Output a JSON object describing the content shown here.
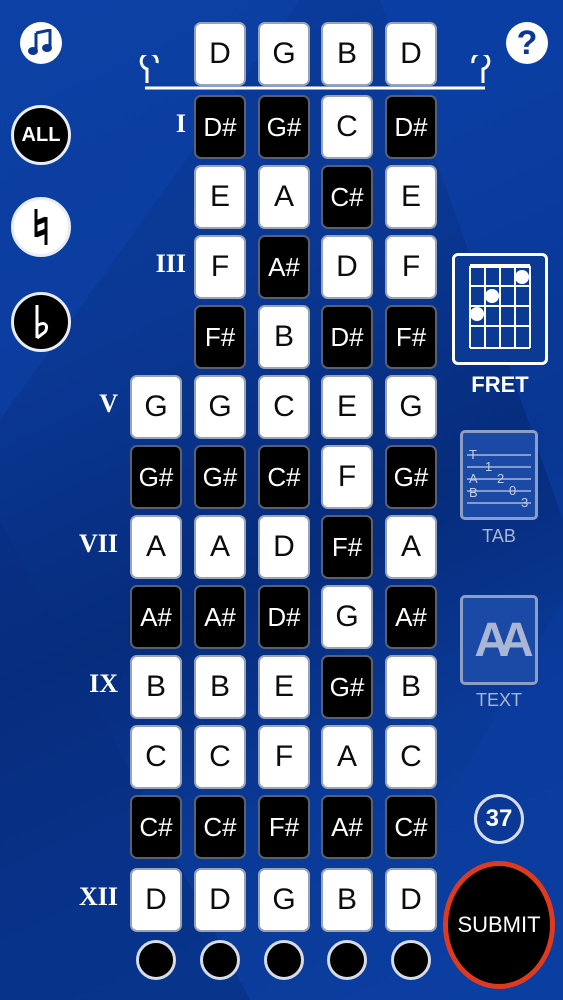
{
  "frets": {
    "open": [
      "D",
      "G",
      "B",
      "D"
    ],
    "rows": [
      {
        "label": "I",
        "notes": [
          "D#",
          "G#",
          "C",
          "D#"
        ]
      },
      {
        "label": "",
        "notes": [
          "E",
          "A",
          "C#",
          "E"
        ]
      },
      {
        "label": "III",
        "notes": [
          "F",
          "A#",
          "D",
          "F"
        ]
      },
      {
        "label": "",
        "notes": [
          "F#",
          "B",
          "D#",
          "F#"
        ]
      },
      {
        "label": "V",
        "notes": [
          "G",
          "G",
          "C",
          "E",
          "G"
        ]
      },
      {
        "label": "",
        "notes": [
          "G#",
          "G#",
          "C#",
          "F",
          "G#"
        ]
      },
      {
        "label": "VII",
        "notes": [
          "A",
          "A",
          "D",
          "F#",
          "A"
        ]
      },
      {
        "label": "",
        "notes": [
          "A#",
          "A#",
          "D#",
          "G",
          "A#"
        ]
      },
      {
        "label": "IX",
        "notes": [
          "B",
          "B",
          "E",
          "G#",
          "B"
        ]
      },
      {
        "label": "",
        "notes": [
          "C",
          "C",
          "F",
          "A",
          "C"
        ]
      },
      {
        "label": "",
        "notes": [
          "C#",
          "C#",
          "F#",
          "A#",
          "C#"
        ]
      },
      {
        "label": "XII",
        "notes": [
          "D",
          "D",
          "G",
          "B",
          "D"
        ]
      }
    ]
  },
  "left_buttons": {
    "all_label": "ALL"
  },
  "right_panel": {
    "fret_label": "FRET",
    "tab_label": "TAB",
    "tab_chars": [
      "T",
      "A",
      "B",
      "1",
      "2",
      "0",
      "3"
    ],
    "text_label": "TEXT",
    "text_glyph": "AA",
    "count": "37",
    "submit_label": "SUBMIT"
  },
  "icons": {
    "top_left": "music-note-icon",
    "top_right": "help-icon",
    "natural": "natural-sign-icon",
    "flat": "flat-sign-icon"
  },
  "colors": {
    "accent_ring": "#e03a1e",
    "background": "#0a3894"
  }
}
